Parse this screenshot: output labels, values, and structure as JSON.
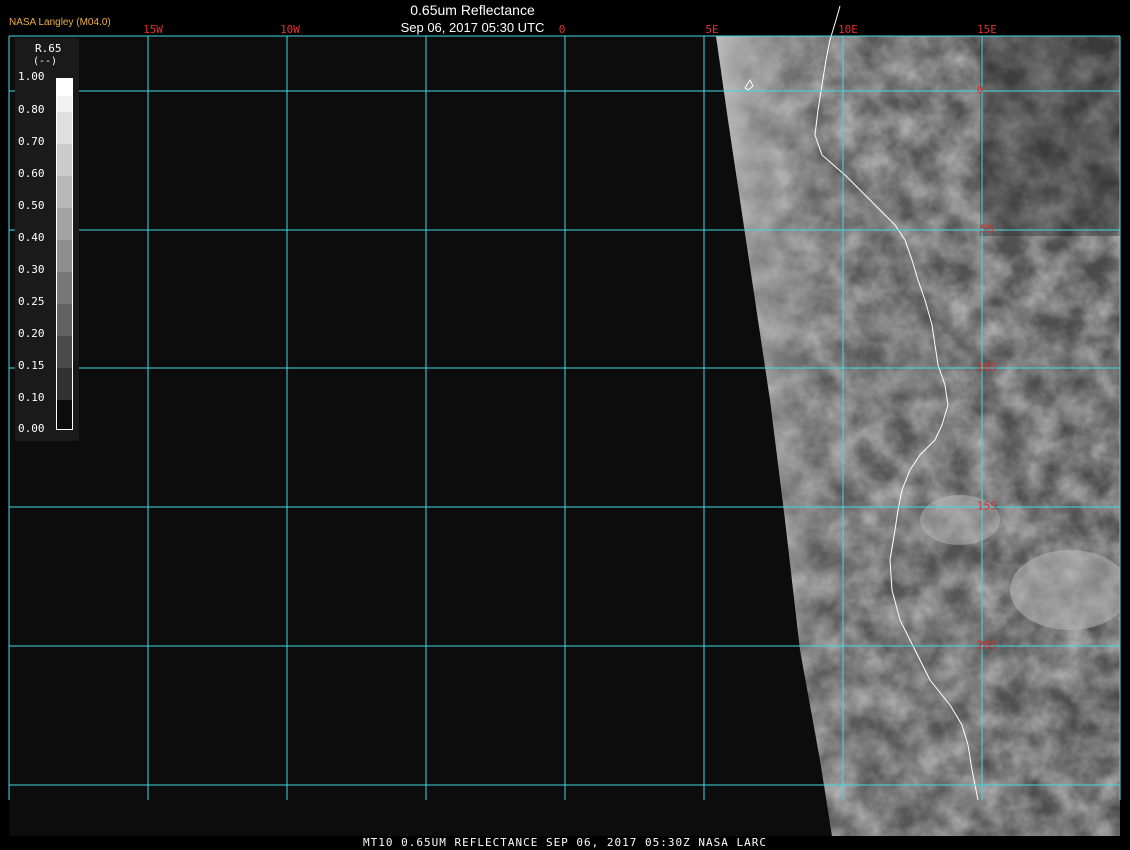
{
  "header": {
    "provider": "NASA Langley (M04.0)",
    "title": "0.65um Reflectance",
    "subtitle": "Sep 06, 2017 05:30 UTC"
  },
  "footer": {
    "caption": "MT10  0.65UM REFLECTANCE   SEP 06, 2017 05:30Z   NASA LARC"
  },
  "legend": {
    "title": "R.65",
    "unit": "(--)",
    "labels": [
      "1.00",
      "0.80",
      "0.70",
      "0.60",
      "0.50",
      "0.40",
      "0.30",
      "0.25",
      "0.20",
      "0.15",
      "0.10",
      "0.00"
    ]
  },
  "grid": {
    "lon_labels": [
      "15W",
      "10W",
      "0",
      "5E",
      "10E",
      "15E"
    ],
    "lat_labels": [
      "0",
      "5S",
      "10S",
      "15S",
      "20S"
    ],
    "color": "#40d8e0"
  },
  "colors": {
    "background": "#000000",
    "ocean": "#0c0c0c",
    "coastline": "#ffffff",
    "grid": "#40d8e0",
    "labels": "#e03030",
    "provider": "#f0b040"
  }
}
